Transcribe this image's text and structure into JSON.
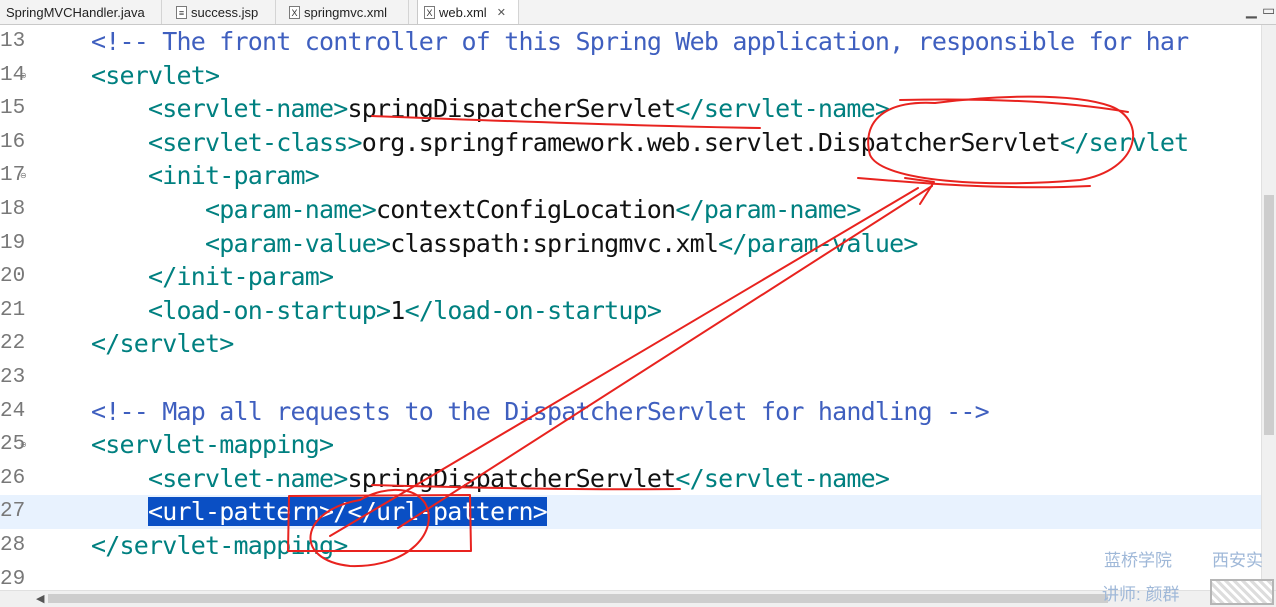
{
  "tabs": [
    {
      "label": "SpringMVCHandler.java",
      "icon": "java-file-icon"
    },
    {
      "label": "success.jsp",
      "icon": "jsp-file-icon"
    },
    {
      "label": "springmvc.xml",
      "icon": "xml-file-icon"
    },
    {
      "label": "web.xml",
      "icon": "xml-file-icon",
      "active": true
    }
  ],
  "editor": {
    "lines": [
      {
        "num": "13",
        "indent": "    ",
        "text": "<!-- The front controller of this Spring Web application, responsible for har"
      },
      {
        "num": "14",
        "indent": "    ",
        "open": "<servlet>"
      },
      {
        "num": "15",
        "indent": "        ",
        "open": "<servlet-name>",
        "value": "springDispatcherServlet",
        "close": "</servlet-name>"
      },
      {
        "num": "16",
        "indent": "        ",
        "open": "<servlet-class>",
        "value": "org.springframework.web.servlet.DispatcherServlet",
        "close": "</servlet"
      },
      {
        "num": "17",
        "indent": "        ",
        "open": "<init-param>"
      },
      {
        "num": "18",
        "indent": "            ",
        "open": "<param-name>",
        "value": "contextConfigLocation",
        "close": "</param-name>"
      },
      {
        "num": "19",
        "indent": "            ",
        "open": "<param-value>",
        "value": "classpath:springmvc.xml",
        "close": "</param-value>"
      },
      {
        "num": "20",
        "indent": "        ",
        "open": "</init-param>"
      },
      {
        "num": "21",
        "indent": "        ",
        "open": "<load-on-startup>",
        "value": "1",
        "close": "</load-on-startup>"
      },
      {
        "num": "22",
        "indent": "    ",
        "open": "</servlet>"
      },
      {
        "num": "23"
      },
      {
        "num": "24",
        "indent": "    ",
        "text": "<!-- Map all requests to the DispatcherServlet for handling -->"
      },
      {
        "num": "25",
        "indent": "    ",
        "open": "<servlet-mapping>"
      },
      {
        "num": "26",
        "indent": "        ",
        "open": "<servlet-name>",
        "value": "springDispatcherServlet",
        "close": "</servlet-name>"
      },
      {
        "num": "27",
        "indent": "        ",
        "selected": "<url-pattern>/</url-pattern>"
      },
      {
        "num": "28",
        "indent": "    ",
        "open": "</servlet-mapping>"
      },
      {
        "num": "29"
      }
    ]
  },
  "watermark": {
    "line1_left": "蓝桥学院",
    "line1_right": "西安实",
    "line2": "讲师: 颜群"
  },
  "colors": {
    "tag": "#008080",
    "comment": "#3f5fbf",
    "selection": "#0a4fc4",
    "annotation": "#e8231f"
  }
}
